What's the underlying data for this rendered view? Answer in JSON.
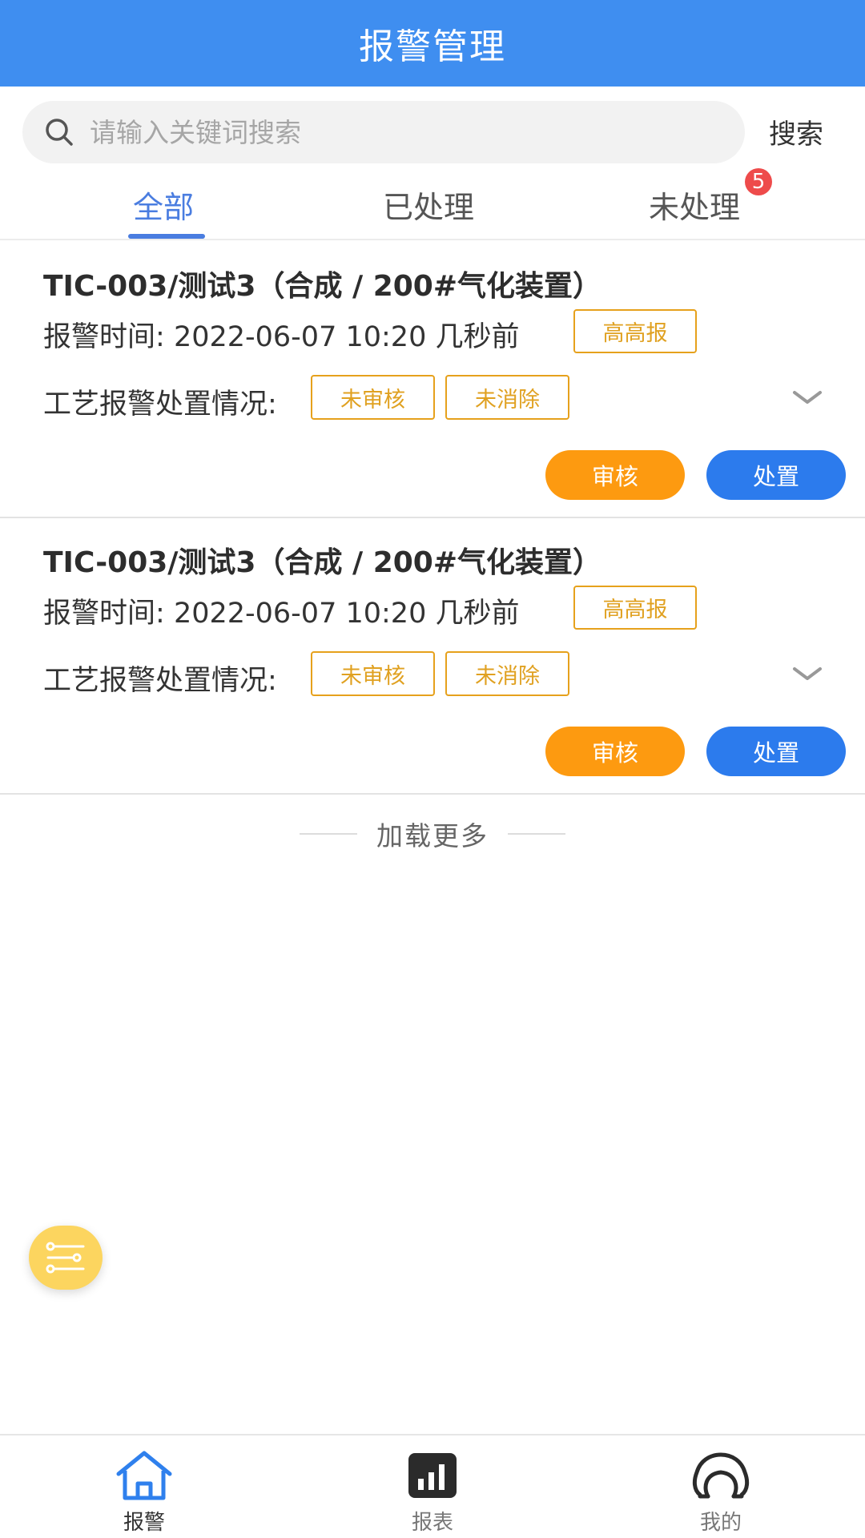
{
  "header": {
    "title": "报警管理"
  },
  "search": {
    "placeholder": "请输入关键词搜索",
    "value": "",
    "button_label": "搜索"
  },
  "tabs": [
    {
      "label": "全部",
      "active": true
    },
    {
      "label": "已处理",
      "active": false
    },
    {
      "label": "未处理",
      "active": false,
      "badge": "5"
    }
  ],
  "alarms": [
    {
      "title": "TIC-003/测试3（合成 / 200#气化装置）",
      "time_label": "报警时间:",
      "time_value": "2022-06-07 10:20",
      "relative_time": "几秒前",
      "level": "高高报",
      "status_label": "工艺报警处置情况:",
      "review_status": "未审核",
      "clear_status": "未消除",
      "review_button": "审核",
      "handle_button": "处置"
    },
    {
      "title": "TIC-003/测试3（合成 / 200#气化装置）",
      "time_label": "报警时间:",
      "time_value": "2022-06-07 10:20",
      "relative_time": "几秒前",
      "level": "高高报",
      "status_label": "工艺报警处置情况:",
      "review_status": "未审核",
      "clear_status": "未消除",
      "review_button": "审核",
      "handle_button": "处置"
    }
  ],
  "load_more": "加载更多",
  "tabbar": [
    {
      "label": "报警",
      "icon": "home-icon",
      "active": true
    },
    {
      "label": "报表",
      "icon": "bar-chart-icon",
      "active": false
    },
    {
      "label": "我的",
      "icon": "user-icon",
      "active": false
    }
  ],
  "colors": {
    "header": "#3f8ef0",
    "active_tab": "#4a7de0",
    "tag_orange": "#e0a121",
    "review_button": "#fd9a10",
    "handle_button": "#2c7bed",
    "badge": "#ee4b4b",
    "fab": "#fcd55f"
  }
}
